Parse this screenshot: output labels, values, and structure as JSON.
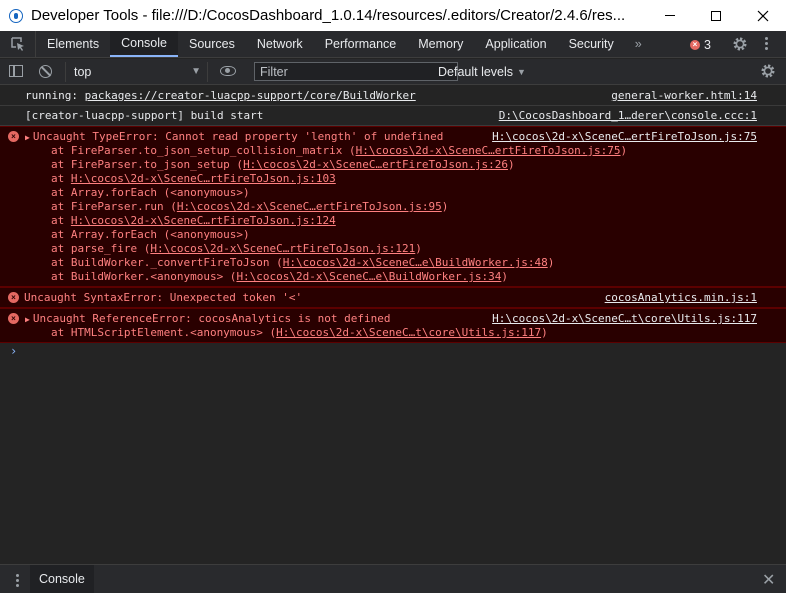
{
  "window": {
    "title": "Developer Tools - file:///D:/CocosDashboard_1.0.14/resources/.editors/Creator/2.4.6/res..."
  },
  "tabs": [
    "Elements",
    "Console",
    "Sources",
    "Network",
    "Performance",
    "Memory",
    "Application",
    "Security"
  ],
  "active_tab": "Console",
  "error_count": "3",
  "toolbar": {
    "context": "top",
    "filter_placeholder": "Filter",
    "levels": "Default levels"
  },
  "messages": [
    {
      "type": "info",
      "label": "running: ",
      "link": "packages://creator-luacpp-support/core/BuildWorker",
      "source": "general-worker.html:14"
    },
    {
      "type": "info",
      "text": "[creator-luacpp-support] build start",
      "source": "D:\\CocosDashboard_1…derer\\console.ccc:1"
    },
    {
      "type": "error",
      "text": "Uncaught TypeError: Cannot read property 'length' of undefined",
      "source": "H:\\cocos\\2d-x\\SceneC…ertFireToJson.js:75",
      "frames": [
        {
          "fn": "at FireParser.to_json_setup_collision_matrix (",
          "link": "H:\\cocos\\2d-x\\SceneC…ertFireToJson.js:75",
          "end": ")"
        },
        {
          "fn": "at FireParser.to_json_setup (",
          "link": "H:\\cocos\\2d-x\\SceneC…ertFireToJson.js:26",
          "end": ")"
        },
        {
          "fn": "at ",
          "link": "H:\\cocos\\2d-x\\SceneC…rtFireToJson.js:103",
          "end": ""
        },
        {
          "fn": "at Array.forEach (<anonymous>)",
          "link": "",
          "end": ""
        },
        {
          "fn": "at FireParser.run (",
          "link": "H:\\cocos\\2d-x\\SceneC…ertFireToJson.js:95",
          "end": ")"
        },
        {
          "fn": "at ",
          "link": "H:\\cocos\\2d-x\\SceneC…rtFireToJson.js:124",
          "end": ""
        },
        {
          "fn": "at Array.forEach (<anonymous>)",
          "link": "",
          "end": ""
        },
        {
          "fn": "at parse_fire (",
          "link": "H:\\cocos\\2d-x\\SceneC…rtFireToJson.js:121",
          "end": ")"
        },
        {
          "fn": "at BuildWorker._convertFireToJson (",
          "link": "H:\\cocos\\2d-x\\SceneC…e\\BuildWorker.js:48",
          "end": ")"
        },
        {
          "fn": "at BuildWorker.<anonymous> (",
          "link": "H:\\cocos\\2d-x\\SceneC…e\\BuildWorker.js:34",
          "end": ")"
        }
      ]
    },
    {
      "type": "error",
      "text": "Uncaught SyntaxError: Unexpected token '<'",
      "source": "cocosAnalytics.min.js:1"
    },
    {
      "type": "error",
      "text": "Uncaught ReferenceError: cocosAnalytics is not defined",
      "source": "H:\\cocos\\2d-x\\SceneC…t\\core\\Utils.js:117",
      "frames": [
        {
          "fn": "at HTMLScriptElement.<anonymous> (",
          "link": "H:\\cocos\\2d-x\\SceneC…t\\core\\Utils.js:117",
          "end": ")"
        }
      ]
    }
  ],
  "prompt": "›",
  "drawer": {
    "tab": "Console"
  },
  "colors": {
    "error_text": "#ff8080",
    "error_bg": "#290000",
    "accent": "#8ab4f8"
  }
}
